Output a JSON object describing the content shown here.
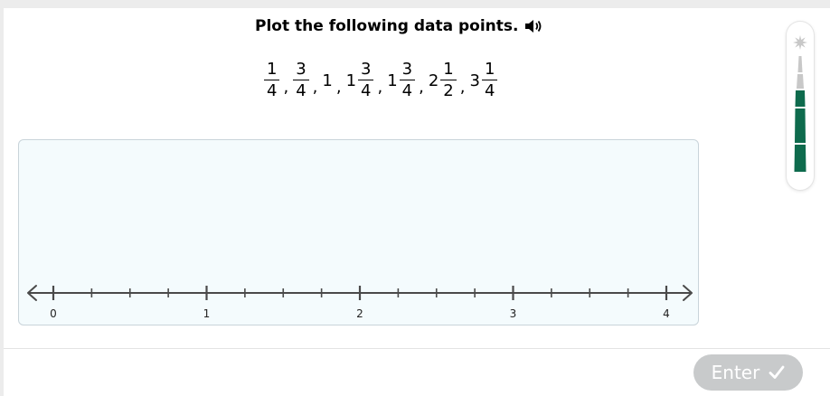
{
  "question": {
    "title": "Plot the following data points.",
    "speaker_icon": "speaker-icon",
    "data_points": [
      {
        "whole": "",
        "num": "1",
        "den": "4"
      },
      {
        "whole": "",
        "num": "3",
        "den": "4"
      },
      {
        "whole": "1",
        "num": "",
        "den": ""
      },
      {
        "whole": "1",
        "num": "3",
        "den": "4"
      },
      {
        "whole": "1",
        "num": "3",
        "den": "4"
      },
      {
        "whole": "2",
        "num": "1",
        "den": "2"
      },
      {
        "whole": "3",
        "num": "1",
        "den": "4"
      }
    ],
    "separator": ","
  },
  "number_line": {
    "min": 0,
    "max": 4,
    "labels": [
      "0",
      "1",
      "2",
      "3",
      "4"
    ],
    "minor_tick_step": 0.25,
    "axis_color": "#4a4a4a",
    "area_background": "#f4fbfd"
  },
  "enter_button": {
    "label": "Enter",
    "icon": "checkmark-icon",
    "state": "disabled",
    "color": "#c8cacb"
  },
  "progress_meter": {
    "icon": "sparkle-icon",
    "segments_total": 5,
    "segments_filled": 3,
    "filled_color": "#0e6b4d",
    "empty_color": "#c8c8c8"
  }
}
